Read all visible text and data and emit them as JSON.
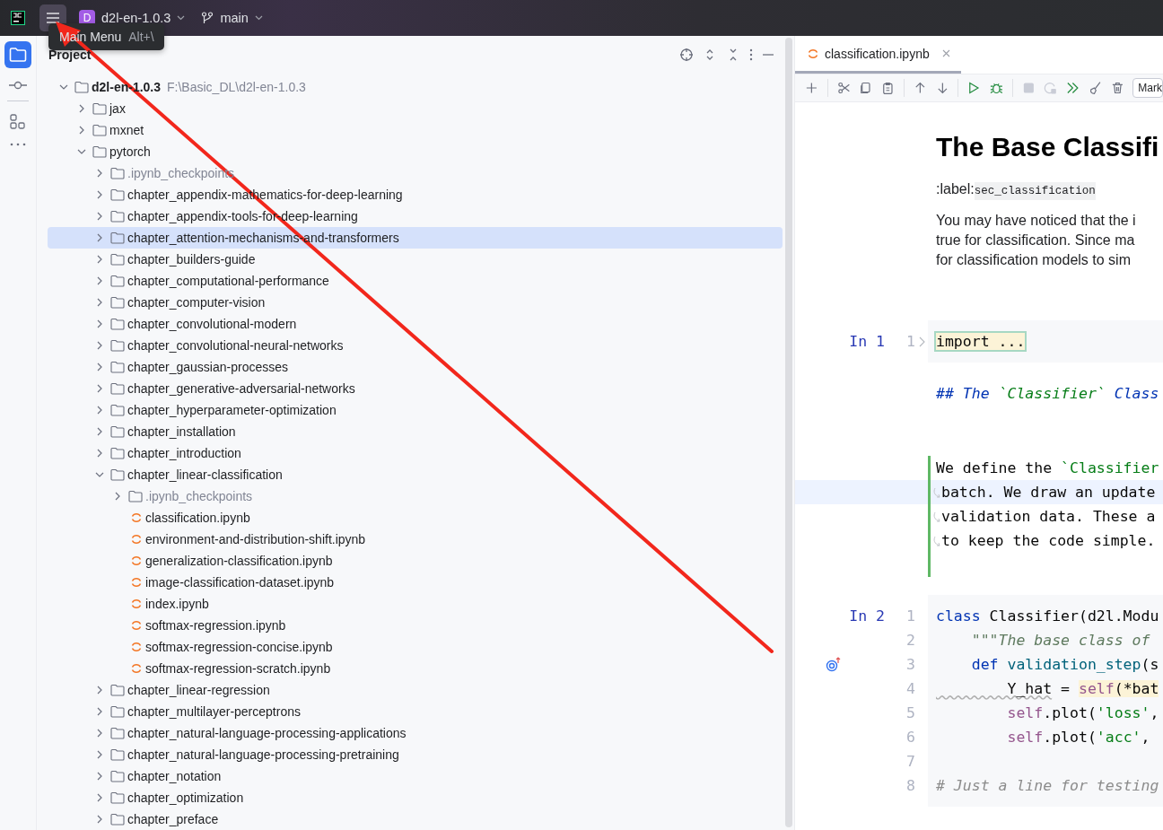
{
  "title_bar": {
    "project_badge": "D",
    "project": "d2l-en-1.0.3",
    "branch": "main"
  },
  "tooltip": {
    "label": "Main Menu",
    "shortcut": "Alt+\\"
  },
  "project_panel": {
    "title": "Project",
    "tree": [
      {
        "name": "d2l-en-1.0.3",
        "kind": "root",
        "path": "F:\\Basic_DL\\d2l-en-1.0.3",
        "expanded": true,
        "selected": false,
        "children": [
          {
            "name": "jax",
            "kind": "folder",
            "expanded": false,
            "selected": false
          },
          {
            "name": "mxnet",
            "kind": "folder",
            "expanded": false,
            "selected": false
          },
          {
            "name": "pytorch",
            "kind": "folder",
            "expanded": true,
            "selected": false,
            "children": [
              {
                "name": ".ipynb_checkpoints",
                "kind": "folder",
                "expanded": false,
                "selected": false,
                "muted": true
              },
              {
                "name": "chapter_appendix-mathematics-for-deep-learning",
                "kind": "folder",
                "expanded": false,
                "selected": false
              },
              {
                "name": "chapter_appendix-tools-for-deep-learning",
                "kind": "folder",
                "expanded": false,
                "selected": false
              },
              {
                "name": "chapter_attention-mechanisms-and-transformers",
                "kind": "folder",
                "expanded": false,
                "selected": true
              },
              {
                "name": "chapter_builders-guide",
                "kind": "folder",
                "expanded": false,
                "selected": false
              },
              {
                "name": "chapter_computational-performance",
                "kind": "folder",
                "expanded": false,
                "selected": false
              },
              {
                "name": "chapter_computer-vision",
                "kind": "folder",
                "expanded": false,
                "selected": false
              },
              {
                "name": "chapter_convolutional-modern",
                "kind": "folder",
                "expanded": false,
                "selected": false
              },
              {
                "name": "chapter_convolutional-neural-networks",
                "kind": "folder",
                "expanded": false,
                "selected": false
              },
              {
                "name": "chapter_gaussian-processes",
                "kind": "folder",
                "expanded": false,
                "selected": false
              },
              {
                "name": "chapter_generative-adversarial-networks",
                "kind": "folder",
                "expanded": false,
                "selected": false
              },
              {
                "name": "chapter_hyperparameter-optimization",
                "kind": "folder",
                "expanded": false,
                "selected": false
              },
              {
                "name": "chapter_installation",
                "kind": "folder",
                "expanded": false,
                "selected": false
              },
              {
                "name": "chapter_introduction",
                "kind": "folder",
                "expanded": false,
                "selected": false
              },
              {
                "name": "chapter_linear-classification",
                "kind": "folder",
                "expanded": true,
                "selected": false,
                "children": [
                  {
                    "name": ".ipynb_checkpoints",
                    "kind": "folder",
                    "expanded": false,
                    "selected": false,
                    "muted": true
                  },
                  {
                    "name": "classification.ipynb",
                    "kind": "notebook",
                    "selected": false
                  },
                  {
                    "name": "environment-and-distribution-shift.ipynb",
                    "kind": "notebook",
                    "selected": false
                  },
                  {
                    "name": "generalization-classification.ipynb",
                    "kind": "notebook",
                    "selected": false
                  },
                  {
                    "name": "image-classification-dataset.ipynb",
                    "kind": "notebook",
                    "selected": false
                  },
                  {
                    "name": "index.ipynb",
                    "kind": "notebook",
                    "selected": false
                  },
                  {
                    "name": "softmax-regression.ipynb",
                    "kind": "notebook",
                    "selected": false
                  },
                  {
                    "name": "softmax-regression-concise.ipynb",
                    "kind": "notebook",
                    "selected": false
                  },
                  {
                    "name": "softmax-regression-scratch.ipynb",
                    "kind": "notebook",
                    "selected": false
                  }
                ]
              },
              {
                "name": "chapter_linear-regression",
                "kind": "folder",
                "expanded": false,
                "selected": false
              },
              {
                "name": "chapter_multilayer-perceptrons",
                "kind": "folder",
                "expanded": false,
                "selected": false
              },
              {
                "name": "chapter_natural-language-processing-applications",
                "kind": "folder",
                "expanded": false,
                "selected": false
              },
              {
                "name": "chapter_natural-language-processing-pretraining",
                "kind": "folder",
                "expanded": false,
                "selected": false
              },
              {
                "name": "chapter_notation",
                "kind": "folder",
                "expanded": false,
                "selected": false
              },
              {
                "name": "chapter_optimization",
                "kind": "folder",
                "expanded": false,
                "selected": false
              },
              {
                "name": "chapter_preface",
                "kind": "folder",
                "expanded": false,
                "selected": false
              }
            ]
          }
        ]
      }
    ]
  },
  "editor": {
    "tabs": [
      {
        "label": "classification.ipynb",
        "selected": true
      }
    ],
    "toolbar": {
      "cell_type": "Mark"
    },
    "cells": [
      {
        "kind": "heading",
        "text": "The Base Classifi"
      },
      {
        "kind": "label",
        "prefix": ":label:",
        "code": "sec_classification"
      },
      {
        "kind": "paragraph",
        "lines": [
          "You may have noticed that the i",
          "true for classification. Since ma",
          "for classification models to sim"
        ]
      },
      {
        "kind": "code",
        "prompt": "In 1",
        "lines": [
          {
            "number": "1",
            "folded": true,
            "tokens": [
              {
                "kind": "fold",
                "text": "import ..."
              }
            ]
          }
        ]
      },
      {
        "kind": "markdown_source",
        "active": false,
        "lines": [
          {
            "current": false,
            "wrapped": false,
            "tokens": [
              {
                "kind": "md",
                "text": "## The "
              },
              {
                "kind": "md_code",
                "text": "`Classifier`"
              },
              {
                "kind": "md",
                "text": " Class"
              }
            ]
          }
        ]
      },
      {
        "kind": "markdown_source",
        "active": true,
        "lines": [
          {
            "current": false,
            "wrapped": false,
            "tokens": [
              {
                "kind": "plain",
                "text": "We define the "
              },
              {
                "kind": "md_code_plain",
                "text": "`Classifier"
              }
            ]
          },
          {
            "current": true,
            "wrapped": true,
            "tokens": [
              {
                "kind": "plain",
                "text": "batch. We draw an update"
              }
            ]
          },
          {
            "current": false,
            "wrapped": true,
            "tokens": [
              {
                "kind": "plain",
                "text": "validation data. These a"
              }
            ]
          },
          {
            "current": false,
            "wrapped": true,
            "tokens": [
              {
                "kind": "plain",
                "text": "to keep the code simple."
              }
            ]
          }
        ]
      },
      {
        "kind": "code",
        "prompt": "In 2",
        "lines": [
          {
            "number": "1",
            "tokens": [
              {
                "kind": "keyword",
                "text": "class"
              },
              {
                "kind": "plain",
                "text": " Classifier(d2l.Modu"
              }
            ]
          },
          {
            "number": "2",
            "tokens": [
              {
                "kind": "docstring",
                "text": "    \"\"\"The base class of"
              }
            ]
          },
          {
            "number": "3",
            "gutter_icon": true,
            "tokens": [
              {
                "kind": "keyword",
                "text": "    def"
              },
              {
                "kind": "func",
                "text": " validation_step"
              },
              {
                "kind": "plain",
                "text": "(s"
              }
            ]
          },
          {
            "number": "4",
            "tokens": [
              {
                "kind": "warn",
                "text": "        Y_hat"
              },
              {
                "kind": "plain",
                "text": " = "
              },
              {
                "kind": "self",
                "text": "self",
                "highlighted": true
              },
              {
                "kind": "plain",
                "text": "(*bat",
                "highlighted": true
              }
            ]
          },
          {
            "number": "5",
            "tokens": [
              {
                "kind": "self",
                "text": "        self"
              },
              {
                "kind": "plain",
                "text": ".plot("
              },
              {
                "kind": "string",
                "text": "'loss'"
              },
              {
                "kind": "plain",
                "text": ","
              }
            ]
          },
          {
            "number": "6",
            "tokens": [
              {
                "kind": "self",
                "text": "        self"
              },
              {
                "kind": "plain",
                "text": ".plot("
              },
              {
                "kind": "string",
                "text": "'acc'"
              },
              {
                "kind": "plain",
                "text": ","
              }
            ]
          },
          {
            "number": "7"
          },
          {
            "number": "8",
            "tokens": [
              {
                "kind": "comment",
                "text": "# Just a line for testing"
              }
            ]
          }
        ]
      }
    ]
  }
}
